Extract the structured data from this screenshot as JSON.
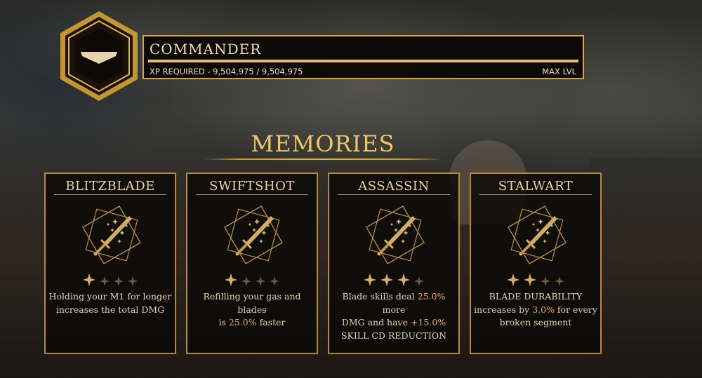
{
  "header": {
    "rank_title": "COMMANDER",
    "xp_required": "XP REQUIRED - 9,504,975 / 9,504,975",
    "level_status": "MAX LVL",
    "xp_progress": 1.0,
    "badge_icon": "chevron-down-icon"
  },
  "section_title": "MEMORIES",
  "colors": {
    "gold": "#d7a93a",
    "highlight": "#e9a94c",
    "star_filled": "#d6b06a",
    "star_empty": "#6a5a3a"
  },
  "memories": [
    {
      "name": "BLITZBLADE",
      "stars_filled": 1,
      "stars_total": 4,
      "desc": [
        [
          {
            "t": "Holding your M1 for longer"
          }
        ],
        [
          {
            "t": "increases the total DMG"
          }
        ]
      ]
    },
    {
      "name": "SWIFTSHOT",
      "stars_filled": 1,
      "stars_total": 4,
      "desc": [
        [
          {
            "t": "Refilling your gas and blades"
          }
        ],
        [
          {
            "t": "is "
          },
          {
            "t": "25.0%",
            "hl": true
          },
          {
            "t": " faster"
          }
        ]
      ]
    },
    {
      "name": "ASSASSIN",
      "stars_filled": 3,
      "stars_total": 4,
      "desc": [
        [
          {
            "t": "Blade skills deal "
          },
          {
            "t": "25.0%",
            "hl": true
          },
          {
            "t": " more"
          }
        ],
        [
          {
            "t": "DMG and have "
          },
          {
            "t": "+15.0%",
            "hl": true
          }
        ],
        [
          {
            "t": "SKILL CD REDUCTION"
          }
        ]
      ]
    },
    {
      "name": "STALWART",
      "stars_filled": 2,
      "stars_total": 4,
      "desc": [
        [
          {
            "t": "BLADE DURABILITY"
          }
        ],
        [
          {
            "t": "increases by "
          },
          {
            "t": "3.0%",
            "hl": true
          },
          {
            "t": " for every"
          }
        ],
        [
          {
            "t": "broken segment"
          }
        ]
      ]
    }
  ]
}
